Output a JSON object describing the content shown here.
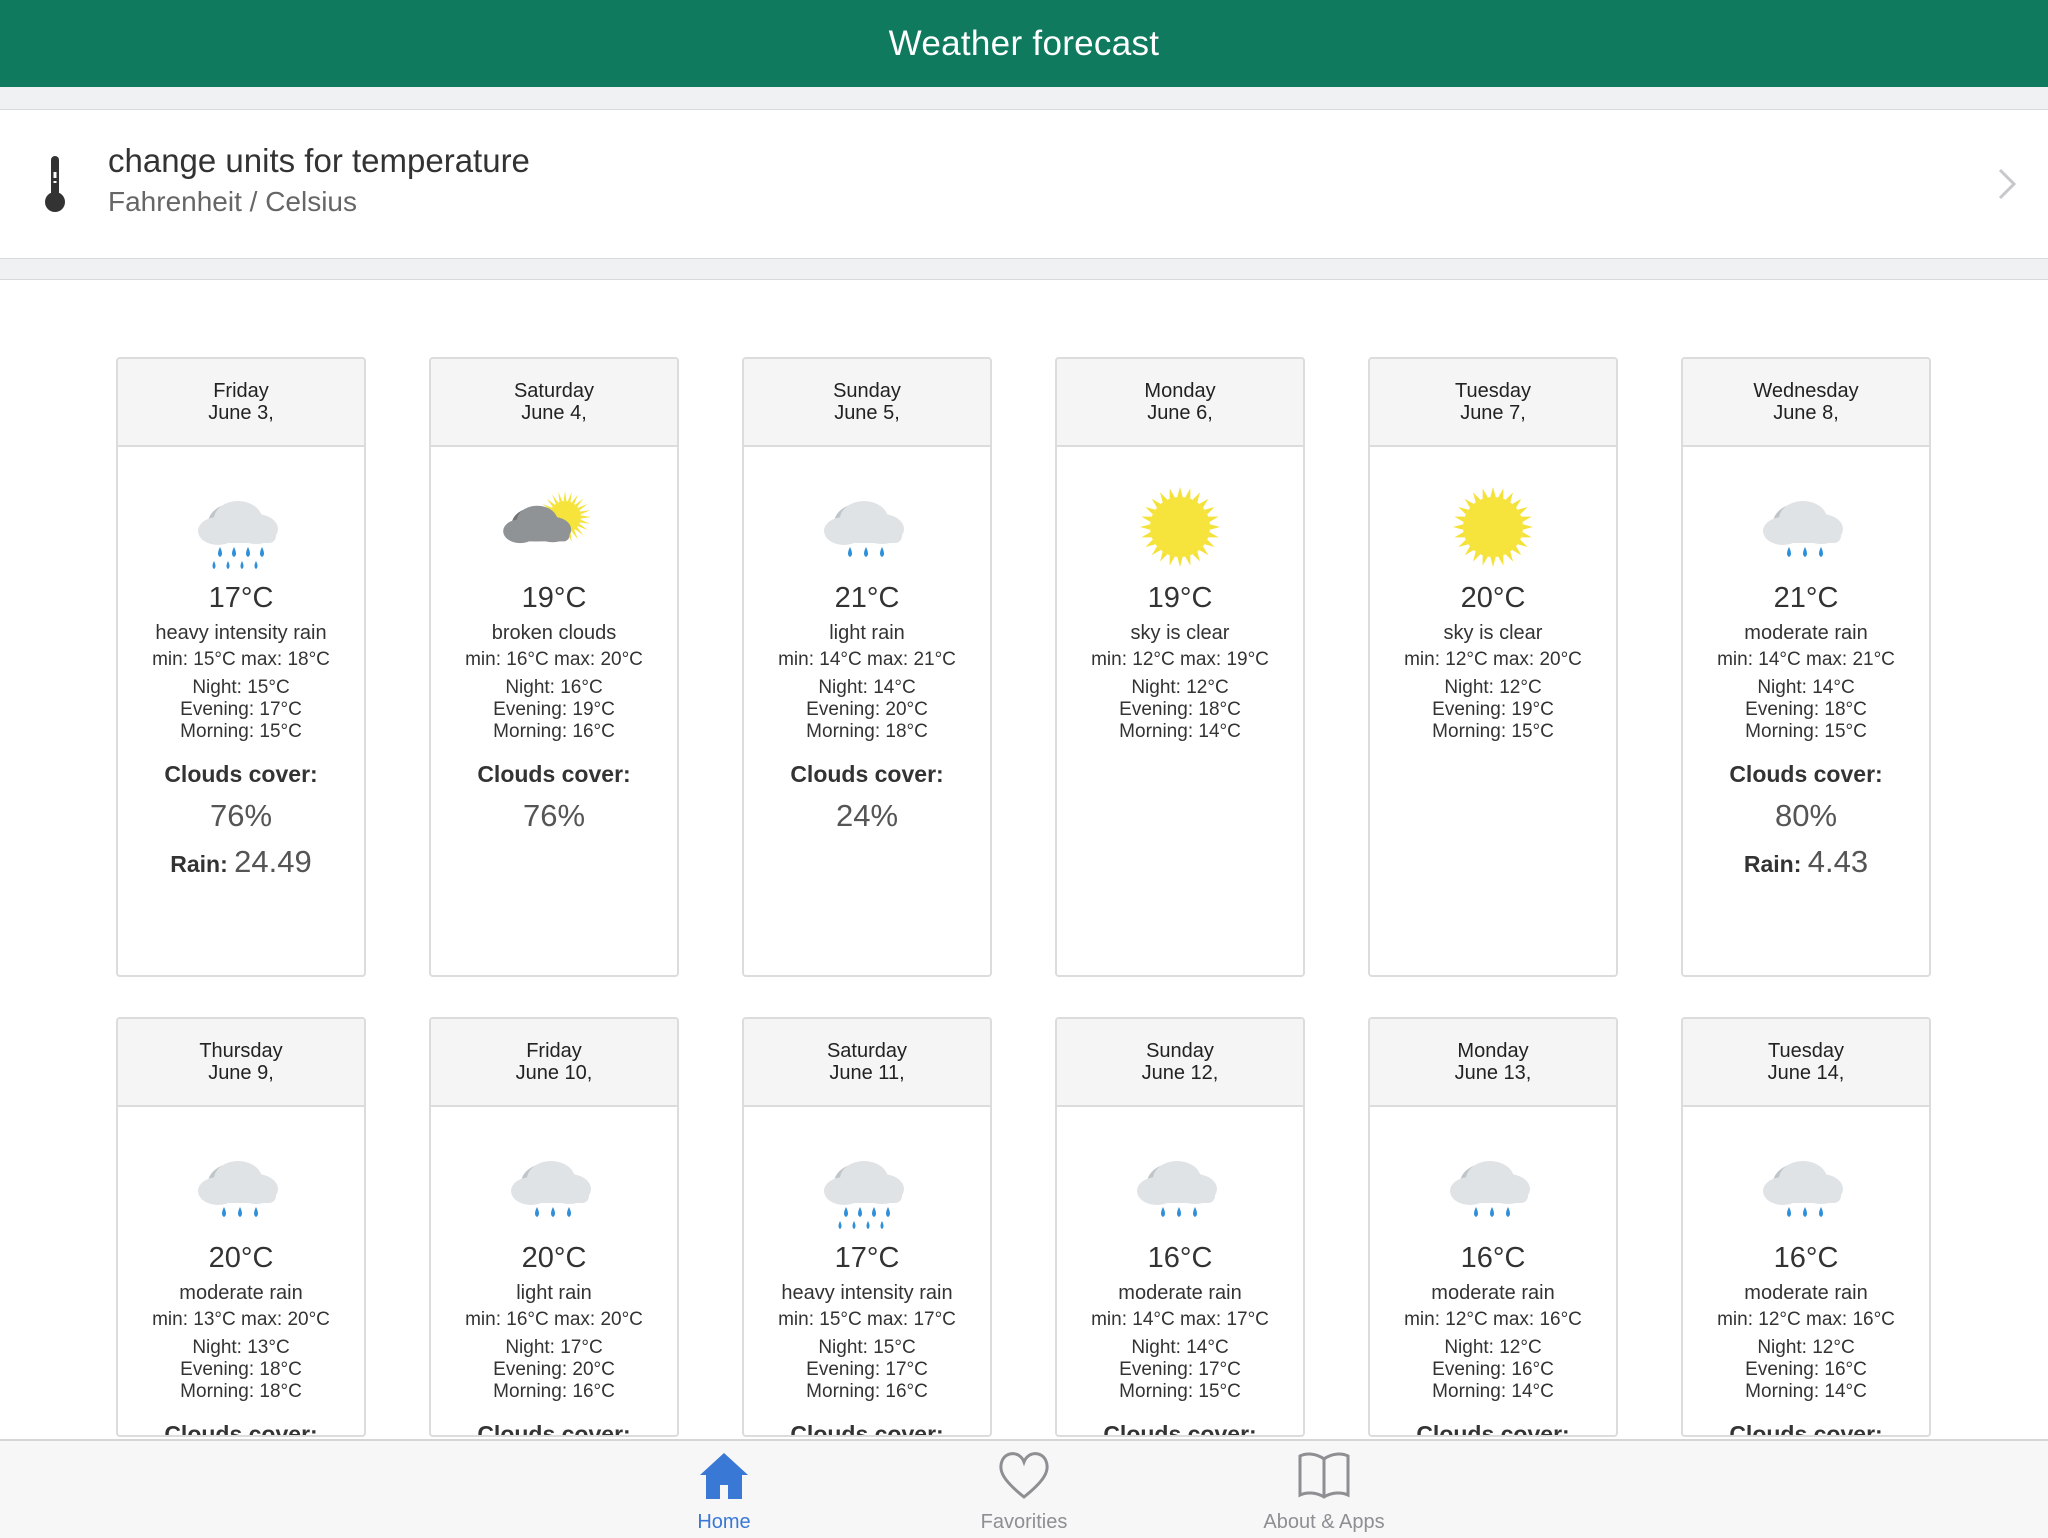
{
  "header": {
    "title": "Weather forecast"
  },
  "units_setting": {
    "title": "change units for temperature",
    "subtitle": "Fahrenheit / Celsius",
    "icon": "thermometer-icon"
  },
  "colors": {
    "header_bg": "#107a5f",
    "active_tab": "#3a78d6",
    "inactive_tab": "#8e8e93"
  },
  "labels": {
    "clouds_cover": "Clouds cover:",
    "rain": "Rain:"
  },
  "days": [
    {
      "weekday": "Friday",
      "date": "June 3,",
      "icon": "heavy-rain-icon",
      "temp": "17°C",
      "description": "heavy intensity rain",
      "minmax": "min: 15°C max: 18°C",
      "night": "Night: 15°C",
      "evening": "Evening: 17°C",
      "morning": "Morning: 15°C",
      "clouds": "76%",
      "rain": "24.49"
    },
    {
      "weekday": "Saturday",
      "date": "June 4,",
      "icon": "broken-clouds-icon",
      "temp": "19°C",
      "description": "broken clouds",
      "minmax": "min: 16°C max: 20°C",
      "night": "Night: 16°C",
      "evening": "Evening: 19°C",
      "morning": "Morning: 16°C",
      "clouds": "76%"
    },
    {
      "weekday": "Sunday",
      "date": "June 5,",
      "icon": "light-rain-icon",
      "temp": "21°C",
      "description": "light rain",
      "minmax": "min: 14°C max: 21°C",
      "night": "Night: 14°C",
      "evening": "Evening: 20°C",
      "morning": "Morning: 18°C",
      "clouds": "24%"
    },
    {
      "weekday": "Monday",
      "date": "June 6,",
      "icon": "sun-icon",
      "temp": "19°C",
      "description": "sky is clear",
      "minmax": "min: 12°C max: 19°C",
      "night": "Night: 12°C",
      "evening": "Evening: 18°C",
      "morning": "Morning: 14°C"
    },
    {
      "weekday": "Tuesday",
      "date": "June 7,",
      "icon": "sun-icon",
      "temp": "20°C",
      "description": "sky is clear",
      "minmax": "min: 12°C max: 20°C",
      "night": "Night: 12°C",
      "evening": "Evening: 19°C",
      "morning": "Morning: 15°C"
    },
    {
      "weekday": "Wednesday",
      "date": "June 8,",
      "icon": "moderate-rain-icon",
      "temp": "21°C",
      "description": "moderate rain",
      "minmax": "min: 14°C max: 21°C",
      "night": "Night: 14°C",
      "evening": "Evening: 18°C",
      "morning": "Morning: 15°C",
      "clouds": "80%",
      "rain": "4.43"
    },
    {
      "weekday": "Thursday",
      "date": "June 9,",
      "icon": "moderate-rain-icon",
      "temp": "20°C",
      "description": "moderate rain",
      "minmax": "min: 13°C max: 20°C",
      "night": "Night: 13°C",
      "evening": "Evening: 18°C",
      "morning": "Morning: 18°C"
    },
    {
      "weekday": "Friday",
      "date": "June 10,",
      "icon": "light-rain-icon",
      "temp": "20°C",
      "description": "light rain",
      "minmax": "min: 16°C max: 20°C",
      "night": "Night: 17°C",
      "evening": "Evening: 20°C",
      "morning": "Morning: 16°C"
    },
    {
      "weekday": "Saturday",
      "date": "June 11,",
      "icon": "heavy-rain-icon",
      "temp": "17°C",
      "description": "heavy intensity rain",
      "minmax": "min: 15°C max: 17°C",
      "night": "Night: 15°C",
      "evening": "Evening: 17°C",
      "morning": "Morning: 16°C"
    },
    {
      "weekday": "Sunday",
      "date": "June 12,",
      "icon": "moderate-rain-icon",
      "temp": "16°C",
      "description": "moderate rain",
      "minmax": "min: 14°C max: 17°C",
      "night": "Night: 14°C",
      "evening": "Evening: 17°C",
      "morning": "Morning: 15°C"
    },
    {
      "weekday": "Monday",
      "date": "June 13,",
      "icon": "moderate-rain-icon",
      "temp": "16°C",
      "description": "moderate rain",
      "minmax": "min: 12°C max: 16°C",
      "night": "Night: 12°C",
      "evening": "Evening: 16°C",
      "morning": "Morning: 14°C"
    },
    {
      "weekday": "Tuesday",
      "date": "June 14,",
      "icon": "moderate-rain-icon",
      "temp": "16°C",
      "description": "moderate rain",
      "minmax": "min: 12°C max: 16°C",
      "night": "Night: 12°C",
      "evening": "Evening: 16°C",
      "morning": "Morning: 14°C"
    }
  ],
  "tabbar": {
    "tabs": [
      {
        "label": "Home",
        "icon": "home-icon",
        "active": true
      },
      {
        "label": "Favorities",
        "icon": "heart-icon",
        "active": false
      },
      {
        "label": "About & Apps",
        "icon": "book-icon",
        "active": false
      }
    ]
  }
}
